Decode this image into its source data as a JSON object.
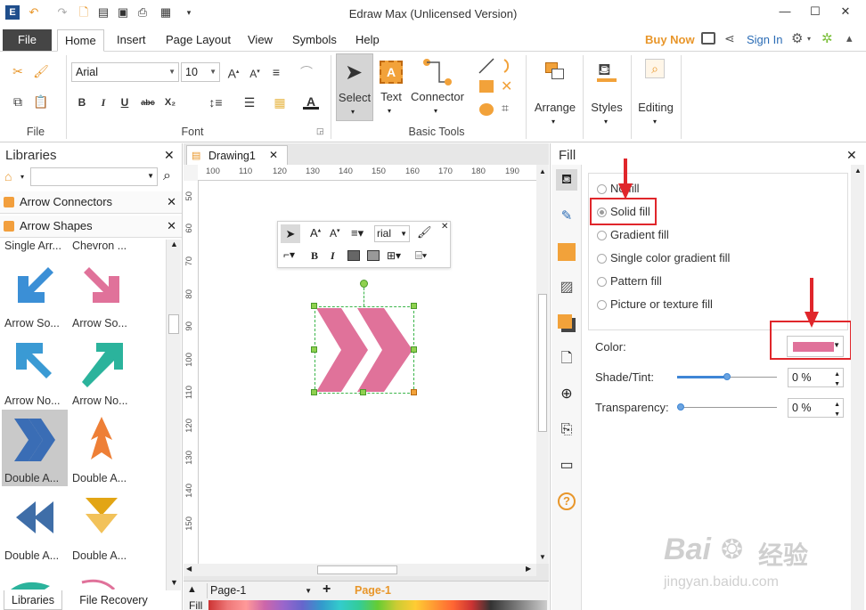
{
  "titlebar": {
    "title": "Edraw Max (Unlicensed Version)",
    "min_icon": "minimize-icon",
    "max_icon": "maximize-icon",
    "close_icon": "close-icon"
  },
  "menu": {
    "file": "File",
    "tabs": [
      "Home",
      "Insert",
      "Page Layout",
      "View",
      "Symbols",
      "Help"
    ],
    "buy_now": "Buy Now",
    "sign_in": "Sign In"
  },
  "ribbon": {
    "group_file": "File",
    "group_font": "Font",
    "group_basic_tools": "Basic Tools",
    "font_name": "Arial",
    "font_size": "10",
    "select_label": "Select",
    "text_label": "Text",
    "connector_label": "Connector",
    "arrange_label": "Arrange",
    "styles_label": "Styles",
    "editing_label": "Editing",
    "text_icon_letter": "A",
    "bold": "B",
    "italic": "I",
    "underline": "U",
    "strike": "abc",
    "subscript": "X₂",
    "font_color": "A"
  },
  "libraries": {
    "title": "Libraries",
    "sections": [
      {
        "label": "Arrow Connectors"
      },
      {
        "label": "Arrow Shapes"
      }
    ],
    "top_labels": [
      "Single Arr...",
      "Chevron ..."
    ],
    "shapes": [
      {
        "label": "Arrow So...",
        "color": "#3b8fd6",
        "icon": "arrow-southwest-icon"
      },
      {
        "label": "Arrow So...",
        "color": "#e0729a",
        "icon": "arrow-southeast-icon"
      },
      {
        "label": "Arrow No...",
        "color": "#3a9ad4",
        "icon": "arrow-northwest-icon"
      },
      {
        "label": "Arrow No...",
        "color": "#2bb39c",
        "icon": "arrow-northeast-icon"
      },
      {
        "label": "Double A...",
        "color": "#3a6db5",
        "icon": "double-arrow-right-icon"
      },
      {
        "label": "Double A...",
        "color": "#ee7f36",
        "icon": "double-arrow-up-icon"
      },
      {
        "label": "Double A...",
        "color": "#3f6ea8",
        "icon": "double-arrow-left-icon"
      },
      {
        "label": "Double A...",
        "color": "#e2a514",
        "icon": "double-arrow-down-icon"
      }
    ],
    "bottom_tabs": [
      "Libraries",
      "File Recovery"
    ]
  },
  "document": {
    "tab_label": "Drawing1",
    "ruler_h": [
      "100",
      "110",
      "120",
      "130",
      "140",
      "150",
      "160",
      "170",
      "180",
      "190"
    ],
    "ruler_v": [
      "50",
      "60",
      "70",
      "80",
      "90",
      "100",
      "110",
      "120",
      "130",
      "140",
      "150"
    ],
    "mini_font": "rial",
    "shape_color": "#e0729a"
  },
  "status": {
    "page_select": "Page-1",
    "page_tab": "Page-1",
    "fill_label": "Fill"
  },
  "fill": {
    "title": "Fill",
    "options": [
      "No fill",
      "Solid fill",
      "Gradient fill",
      "Single color gradient fill",
      "Pattern fill",
      "Picture or texture fill"
    ],
    "selected": "Solid fill",
    "color_label": "Color:",
    "color_value": "#e0729a",
    "shade_label": "Shade/Tint:",
    "shade_value": "0 %",
    "shade_level": 0.5,
    "transparency_label": "Transparency:",
    "transparency_value": "0 %",
    "transparency_level": 0,
    "highlight_color": "#e0262b"
  },
  "watermark": {
    "text1": "Bai",
    "text2": "经验",
    "url": "jingyan.baidu.com"
  }
}
